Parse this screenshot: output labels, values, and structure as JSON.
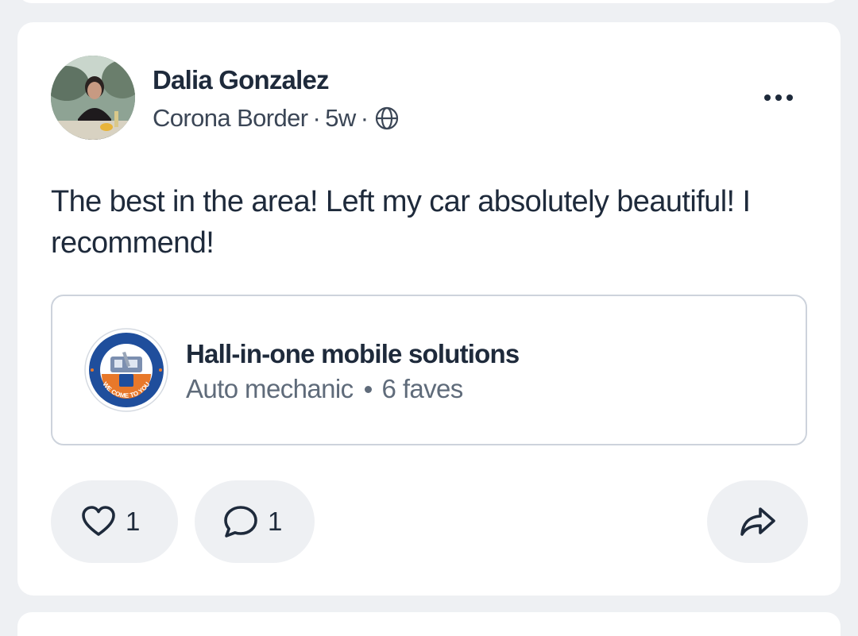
{
  "post": {
    "author": "Dalia Gonzalez",
    "location": "Corona Border",
    "separator": "·",
    "age": "5w",
    "visibility_icon": "globe-icon",
    "more_icon": "more-horizontal-icon",
    "text": "The best in the area! Left my car absolutely beautiful! I recommend!"
  },
  "business": {
    "name": "Hall-in-one mobile solutions",
    "category": "Auto mechanic",
    "faves": "6 faves",
    "logo_text": "WE COME TO YOU"
  },
  "actions": {
    "like_icon": "heart-icon",
    "like_count": "1",
    "comment_icon": "comment-bubble-icon",
    "comment_count": "1",
    "share_icon": "share-arrow-icon"
  },
  "colors": {
    "background": "#eef0f3",
    "card": "#ffffff",
    "text_primary": "#1e2a3b",
    "text_secondary": "#5f6b7a",
    "border": "#cdd3dc",
    "logo_blue": "#1f4e9c",
    "logo_orange": "#e8782a"
  }
}
